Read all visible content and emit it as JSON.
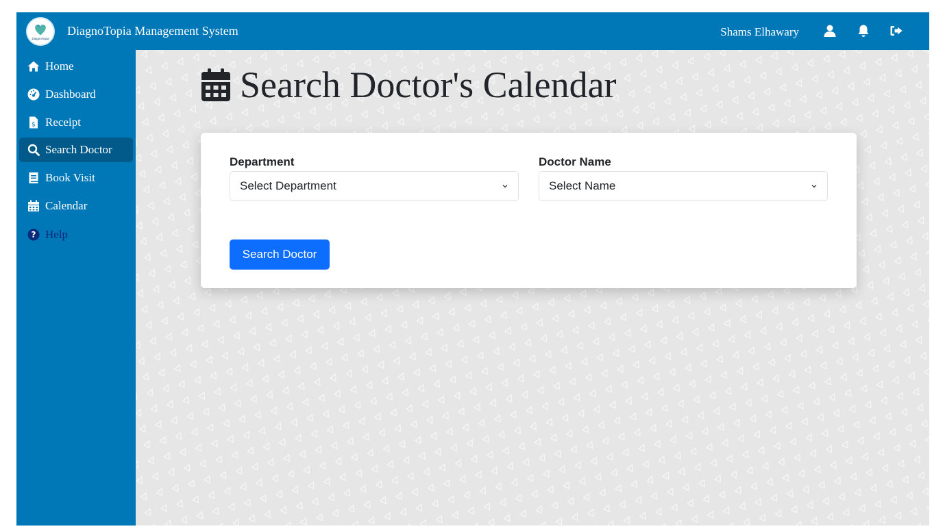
{
  "app": {
    "logo_text": "DiagnoTopia",
    "title": "DiagnoTopia Management System"
  },
  "header": {
    "user_name": "Shams Elhawary",
    "icons": [
      "user-icon",
      "bell-icon",
      "logout-icon"
    ]
  },
  "sidebar": {
    "items": [
      {
        "label": "Home",
        "icon": "home-icon",
        "active": false
      },
      {
        "label": "Dashboard",
        "icon": "dashboard-icon",
        "active": false
      },
      {
        "label": "Receipt",
        "icon": "receipt-icon",
        "active": false
      },
      {
        "label": "Search Doctor",
        "icon": "search-icon",
        "active": true
      },
      {
        "label": "Book Visit",
        "icon": "book-icon",
        "active": false
      },
      {
        "label": "Calendar",
        "icon": "calendar-icon",
        "active": false
      },
      {
        "label": "Help",
        "icon": "help-icon",
        "active": false
      }
    ]
  },
  "main": {
    "page_title": "Search Doctor's Calendar",
    "form": {
      "department_label": "Department",
      "department_value": "Select Department",
      "doctor_label": "Doctor Name",
      "doctor_value": "Select Name",
      "submit_label": "Search Doctor"
    }
  },
  "colors": {
    "brand": "#0077b6",
    "sidebar_active": "#015a8a",
    "primary_button": "#0d6efd",
    "background": "#e6e6e6"
  }
}
